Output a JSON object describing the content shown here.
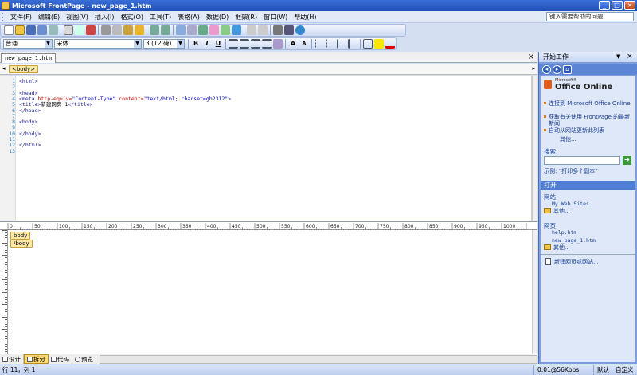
{
  "window": {
    "title": "Microsoft FrontPage - new_page_1.htm",
    "min": "_",
    "max": "□",
    "close": "×"
  },
  "menu": {
    "items": [
      "文件(F)",
      "编辑(E)",
      "视图(V)",
      "插入(I)",
      "格式(O)",
      "工具(T)",
      "表格(A)",
      "数据(D)",
      "框架(R)",
      "窗口(W)",
      "帮助(H)"
    ],
    "help_placeholder": "键入需要帮助的问题"
  },
  "format_bar": {
    "style": "普通",
    "font": "宋体",
    "size": "3 (12 磅)",
    "bold": "B",
    "italic": "I",
    "underline": "U",
    "grow": "A",
    "shrink": "A"
  },
  "document": {
    "tab": "new_page_1.htm",
    "close": "×",
    "tag": "<body>",
    "code_lines": [
      {
        "n": "1",
        "parts": [
          {
            "t": "<html>",
            "c": "tag"
          }
        ]
      },
      {
        "n": "2",
        "parts": []
      },
      {
        "n": "3",
        "parts": [
          {
            "t": "<head>",
            "c": "tag"
          }
        ]
      },
      {
        "n": "4",
        "parts": [
          {
            "t": "<meta ",
            "c": "tag"
          },
          {
            "t": "http-equiv=",
            "c": "attr"
          },
          {
            "t": "\"Content-Type\"",
            "c": "val"
          },
          {
            "t": " content=",
            "c": "attr"
          },
          {
            "t": "\"text/html; charset=gb2312\"",
            "c": "val"
          },
          {
            "t": ">",
            "c": "tag"
          }
        ]
      },
      {
        "n": "5",
        "parts": [
          {
            "t": "<title>",
            "c": "tag"
          },
          {
            "t": "新建网页 1",
            "c": "txt"
          },
          {
            "t": "</title>",
            "c": "tag"
          }
        ]
      },
      {
        "n": "6",
        "parts": [
          {
            "t": "</head>",
            "c": "tag"
          }
        ]
      },
      {
        "n": "7",
        "parts": []
      },
      {
        "n": "8",
        "parts": [
          {
            "t": "<body>",
            "c": "tag"
          }
        ]
      },
      {
        "n": "9",
        "parts": []
      },
      {
        "n": "10",
        "parts": [
          {
            "t": "</body>",
            "c": "tag"
          }
        ]
      },
      {
        "n": "11",
        "parts": []
      },
      {
        "n": "12",
        "parts": [
          {
            "t": "</html>",
            "c": "tag"
          }
        ]
      },
      {
        "n": "13",
        "parts": []
      }
    ]
  },
  "ruler": {
    "labels": [
      "0",
      "50",
      "100",
      "150",
      "200",
      "250",
      "300",
      "350",
      "400",
      "450",
      "500",
      "550",
      "600",
      "650",
      "700",
      "750",
      "800",
      "850",
      "900",
      "950",
      "1000",
      "1050"
    ]
  },
  "design": {
    "tag1": "body",
    "tag2": "/body"
  },
  "view_tabs": [
    "设计",
    "拆分",
    "代码",
    "预览"
  ],
  "status": {
    "position": "行 11，列 1",
    "speed": "0:01@56Kbps",
    "mode": "默认",
    "custom": "自定义"
  },
  "taskpane": {
    "title": "开始工作",
    "logo_small": "Microsoft®",
    "logo": "Office Online",
    "links": [
      "连接到 Microsoft Office Online",
      "获取有关使用 FrontPage 的最新新闻",
      "自动从网站更新此列表"
    ],
    "more1": "其他...",
    "search_label": "搜索:",
    "search_example": "示例: “打印多个副本”",
    "open_header": "打开",
    "sites_label": "网站",
    "site1": "My Web Sites",
    "more2": "其他...",
    "pages_label": "网页",
    "page1": "help.htm",
    "page2": "new_page_1.htm",
    "more3": "其他...",
    "new_link": "新建网页或网站..."
  }
}
